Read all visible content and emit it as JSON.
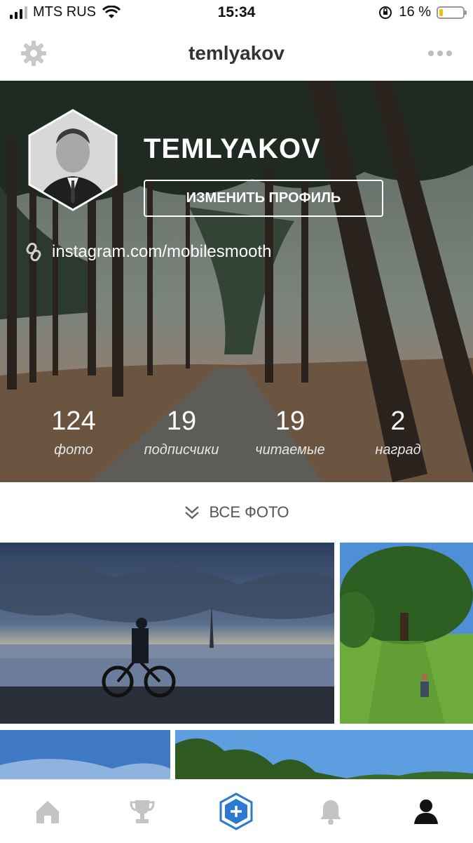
{
  "status_bar": {
    "carrier": "MTS RUS",
    "time": "15:34",
    "battery": "16 %"
  },
  "nav": {
    "title": "temlyakov",
    "settings_icon": "gear-icon",
    "more_icon": "more-dots-icon"
  },
  "profile": {
    "username": "TEMLYAKOV",
    "edit_button": "ИЗМЕНИТЬ ПРОФИЛЬ",
    "link": "instagram.com/mobilesmooth",
    "link_icon": "link-icon"
  },
  "stats": [
    {
      "value": "124",
      "label": "фото"
    },
    {
      "value": "19",
      "label": "подписчики"
    },
    {
      "value": "19",
      "label": "читаемые"
    },
    {
      "value": "2",
      "label": "наград"
    }
  ],
  "all_photos": {
    "label": "ВСЕ ФОТО",
    "icon": "double-chevron-down-icon"
  },
  "tabs": [
    {
      "name": "home",
      "icon": "home-icon"
    },
    {
      "name": "awards",
      "icon": "trophy-icon"
    },
    {
      "name": "upload",
      "icon": "add-photo-icon"
    },
    {
      "name": "notifications",
      "icon": "bell-icon"
    },
    {
      "name": "profile",
      "icon": "user-icon"
    }
  ],
  "colors": {
    "accent": "#2a7ad1",
    "tab_inactive": "#c4c4c4",
    "tab_active": "#111111"
  }
}
